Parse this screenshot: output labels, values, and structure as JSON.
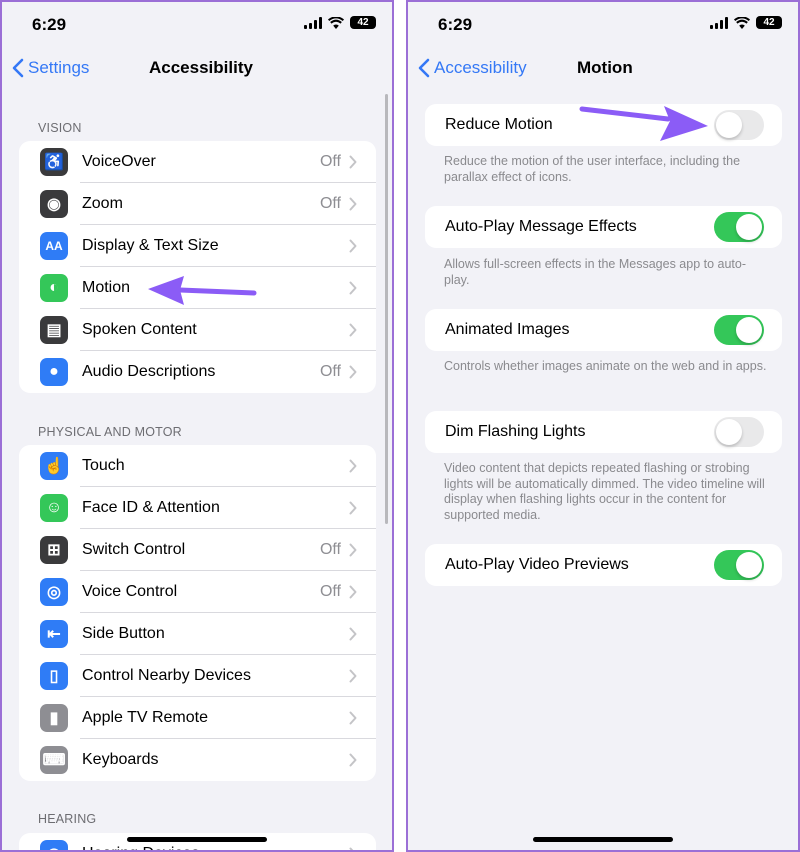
{
  "left": {
    "status_time": "6:29",
    "battery": "42",
    "back_label": "Settings",
    "title": "Accessibility",
    "sections": [
      {
        "header": "VISION",
        "items": [
          {
            "label": "VoiceOver",
            "value": "Off",
            "icon": "voiceover-icon",
            "color": "#3a3a3c"
          },
          {
            "label": "Zoom",
            "value": "Off",
            "icon": "zoom-icon",
            "color": "#3a3a3c"
          },
          {
            "label": "Display & Text Size",
            "value": "",
            "icon": "text-size-icon",
            "color": "#2f7cf6"
          },
          {
            "label": "Motion",
            "value": "",
            "icon": "motion-icon",
            "color": "#34c759"
          },
          {
            "label": "Spoken Content",
            "value": "",
            "icon": "spoken-content-icon",
            "color": "#3a3a3c"
          },
          {
            "label": "Audio Descriptions",
            "value": "Off",
            "icon": "audio-descriptions-icon",
            "color": "#2f7cf6"
          }
        ]
      },
      {
        "header": "PHYSICAL AND MOTOR",
        "items": [
          {
            "label": "Touch",
            "value": "",
            "icon": "touch-icon",
            "color": "#2f7cf6"
          },
          {
            "label": "Face ID & Attention",
            "value": "",
            "icon": "face-id-icon",
            "color": "#34c759"
          },
          {
            "label": "Switch Control",
            "value": "Off",
            "icon": "switch-control-icon",
            "color": "#3a3a3c"
          },
          {
            "label": "Voice Control",
            "value": "Off",
            "icon": "voice-control-icon",
            "color": "#2f7cf6"
          },
          {
            "label": "Side Button",
            "value": "",
            "icon": "side-button-icon",
            "color": "#2f7cf6"
          },
          {
            "label": "Control Nearby Devices",
            "value": "",
            "icon": "nearby-devices-icon",
            "color": "#2f7cf6"
          },
          {
            "label": "Apple TV Remote",
            "value": "",
            "icon": "tv-remote-icon",
            "color": "#8e8e93"
          },
          {
            "label": "Keyboards",
            "value": "",
            "icon": "keyboard-icon",
            "color": "#8e8e93"
          }
        ]
      },
      {
        "header": "HEARING",
        "items": [
          {
            "label": "Hearing Devices",
            "value": "",
            "icon": "hearing-devices-icon",
            "color": "#2f7cf6"
          }
        ]
      }
    ]
  },
  "right": {
    "status_time": "6:29",
    "battery": "42",
    "back_label": "Accessibility",
    "title": "Motion",
    "settings": [
      {
        "label": "Reduce Motion",
        "on": false,
        "footer": "Reduce the motion of the user interface, including the parallax effect of icons."
      },
      {
        "label": "Auto-Play Message Effects",
        "on": true,
        "footer": "Allows full-screen effects in the Messages app to auto-play."
      },
      {
        "label": "Animated Images",
        "on": true,
        "footer": "Controls whether images animate on the web and in apps."
      },
      {
        "label": "Dim Flashing Lights",
        "on": false,
        "footer": "Video content that depicts repeated flashing or strobing lights will be automatically dimmed. The video timeline will display when flashing lights occur in the content for supported media."
      },
      {
        "label": "Auto-Play Video Previews",
        "on": true,
        "footer": ""
      }
    ]
  },
  "colors": {
    "accent": "#3478f6",
    "toggle_on": "#34c759",
    "annotation_arrow": "#8b5cf6",
    "frame_border": "#9b6fd6"
  }
}
